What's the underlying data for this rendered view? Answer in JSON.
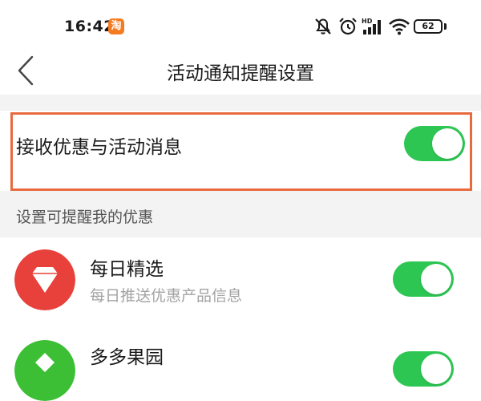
{
  "status_bar": {
    "time": "16:42",
    "app_badge": "淘",
    "battery": "62",
    "icons": [
      "mute-bell-icon",
      "alarm-icon",
      "hd-signal-icon",
      "wifi-icon",
      "battery-icon"
    ]
  },
  "nav": {
    "title": "活动通知提醒设置",
    "back_icon": "chevron-left-icon"
  },
  "master": {
    "label": "接收优惠与活动消息",
    "enabled": true
  },
  "section": {
    "title": "设置可提醒我的优惠"
  },
  "items": [
    {
      "title": "每日精选",
      "subtitle": "每日推送优惠产品信息",
      "icon": "diamond-icon",
      "icon_color": "#e8403a",
      "enabled": true
    },
    {
      "title": "多多果园",
      "icon": "orchard-icon",
      "icon_color": "#3cbf34",
      "enabled": true
    }
  ],
  "colors": {
    "toggle_on": "#2dc653",
    "highlight": "#e86a3e",
    "section_bg": "#f3f3f3"
  }
}
